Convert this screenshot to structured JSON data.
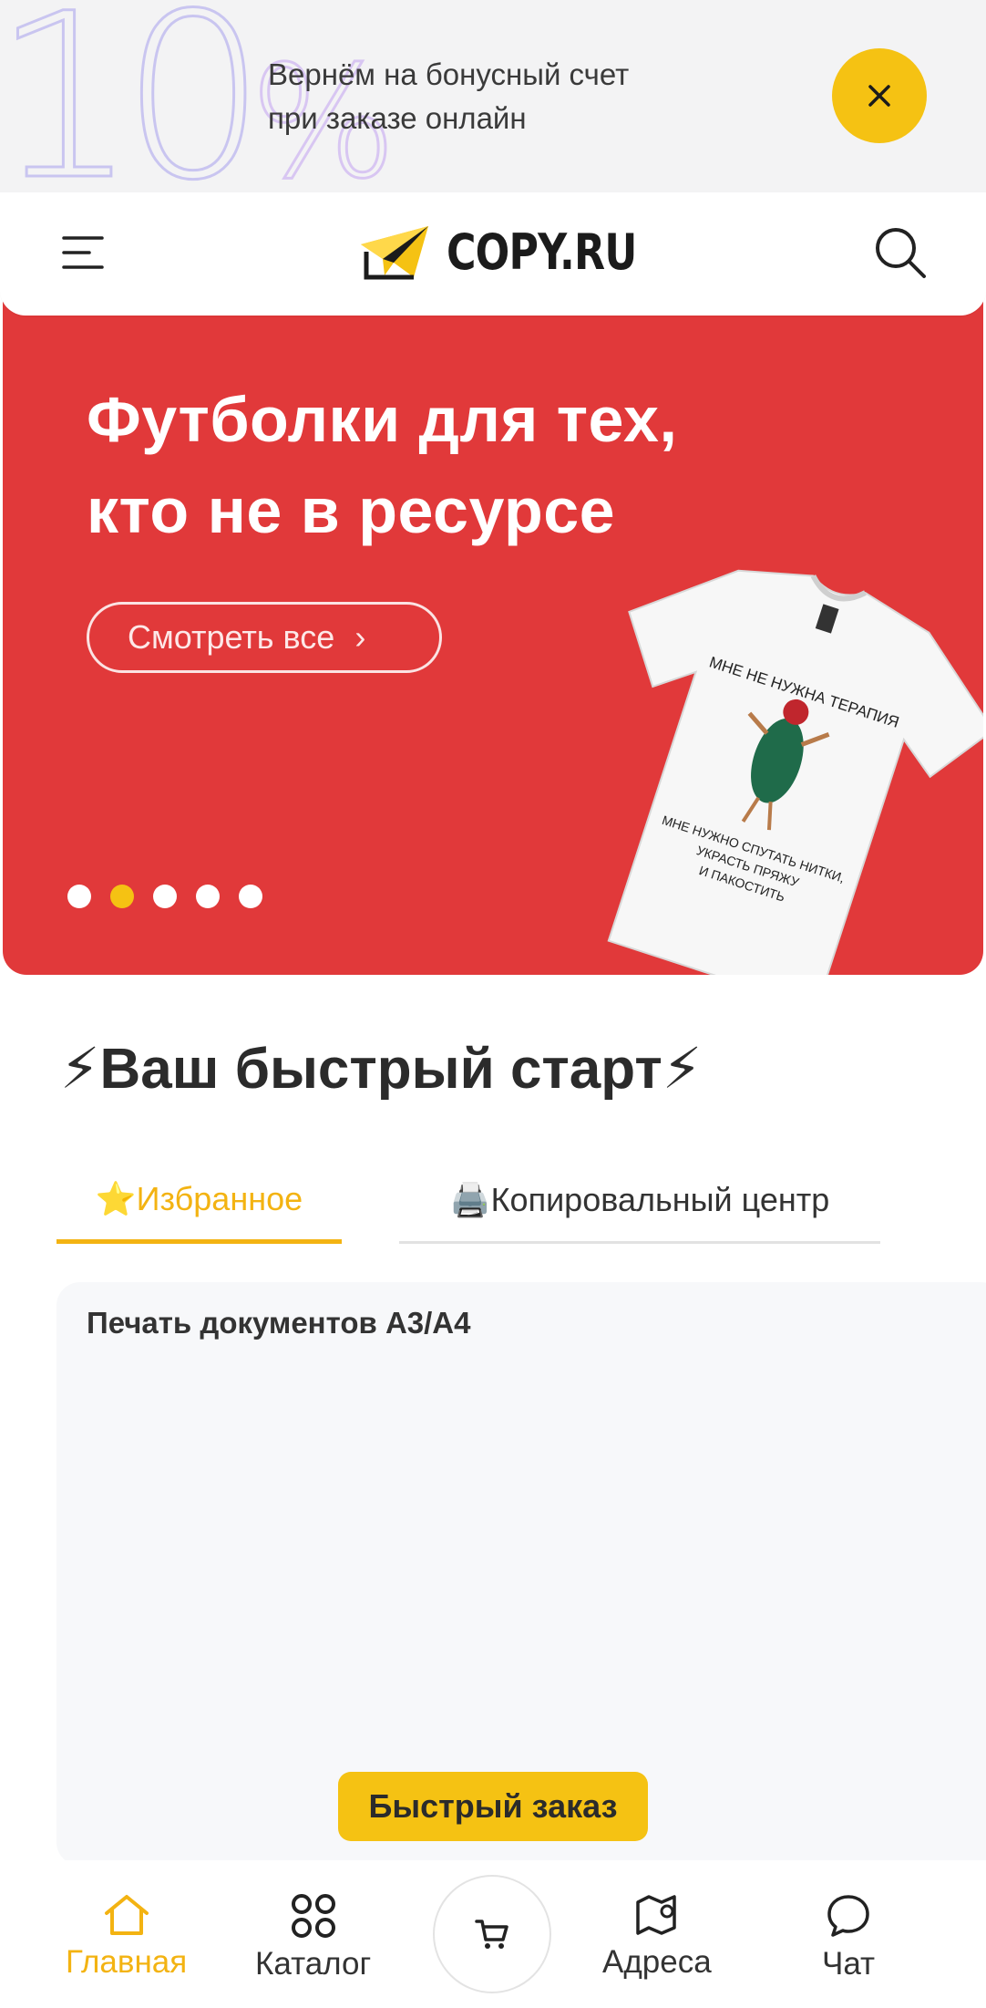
{
  "promo": {
    "big_text": "10",
    "big_percent": "%",
    "line1": "Вернём на бонусный счет",
    "line2": "при заказе онлайн",
    "close_icon": "close-icon"
  },
  "header": {
    "logo_text": "COPY.RU",
    "menu_icon": "hamburger-icon",
    "search_icon": "search-icon"
  },
  "hero": {
    "title_line1": "Футболки для тех,",
    "title_line2": "кто не в ресурсе",
    "button_label": "Смотреть все",
    "button_arrow": "›",
    "shirt_text_top": "МНЕ НЕ НУЖНА ТЕРАПИЯ",
    "shirt_text_bottom1": "МНЕ НУЖНО СПУТАТЬ НИТКИ,",
    "shirt_text_bottom2": "УКРАСТЬ ПРЯЖУ",
    "shirt_text_bottom3": "И ПАКОСТИТЬ",
    "slide_count": 5,
    "active_slide": 2,
    "background_color": "#e1393a"
  },
  "quick_start": {
    "title": "⚡Ваш быстрый старт⚡",
    "tabs": [
      {
        "label": "⭐Избранное",
        "active": true
      },
      {
        "label": "🖨️Копировальный центр",
        "active": false
      }
    ]
  },
  "card": {
    "title": "Печать документов А3/А4",
    "button_label": "Быстрый заказ"
  },
  "bottom_nav": {
    "items": [
      {
        "label": "Главная",
        "icon": "home-icon",
        "active": true
      },
      {
        "label": "Каталог",
        "icon": "grid-icon",
        "active": false
      },
      {
        "label": "",
        "icon": "cart-icon",
        "active": false
      },
      {
        "label": "Адреса",
        "icon": "map-icon",
        "active": false
      },
      {
        "label": "Чат",
        "icon": "chat-icon",
        "active": false
      }
    ]
  },
  "colors": {
    "accent": "#f5c213",
    "accent_text": "#f3b312",
    "hero_red": "#e1393a"
  }
}
